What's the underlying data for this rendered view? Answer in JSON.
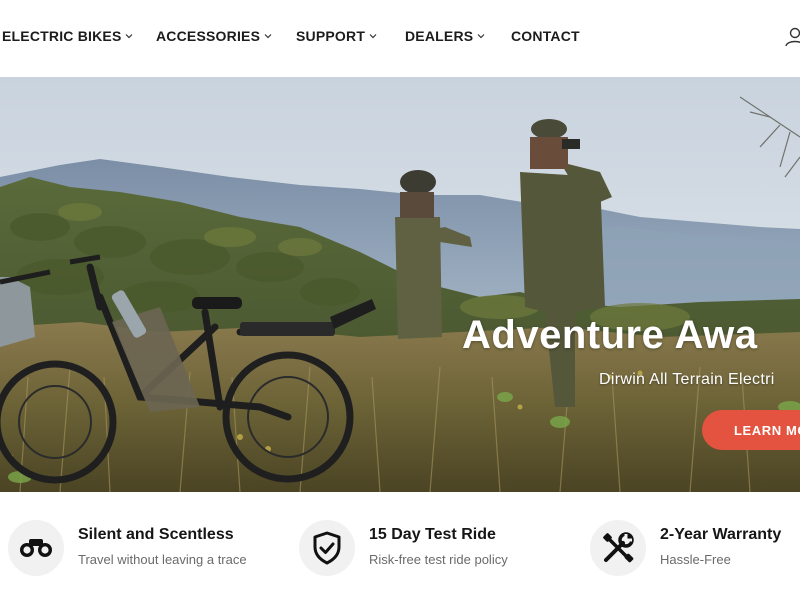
{
  "nav": {
    "items": [
      {
        "label": "ELECTRIC BIKES",
        "has_dropdown": true
      },
      {
        "label": "ACCESSORIES",
        "has_dropdown": true
      },
      {
        "label": "SUPPORT",
        "has_dropdown": true
      },
      {
        "label": "DEALERS",
        "has_dropdown": true
      },
      {
        "label": "CONTACT",
        "has_dropdown": false
      }
    ],
    "account_icon": "user-icon"
  },
  "hero": {
    "title": "Adventure Awa",
    "subtitle": "Dirwin All Terrain Electri",
    "cta_label": "LEARN MO",
    "cta_color": "#e4533f"
  },
  "features": [
    {
      "icon": "binoculars-icon",
      "title": "Silent and Scentless",
      "subtitle": "Travel without leaving a trace"
    },
    {
      "icon": "shield-check-icon",
      "title": "15 Day Test Ride",
      "subtitle": "Risk-free test ride policy"
    },
    {
      "icon": "tools-icon",
      "title": "2-Year Warranty",
      "subtitle": "Hassle-Free"
    }
  ]
}
